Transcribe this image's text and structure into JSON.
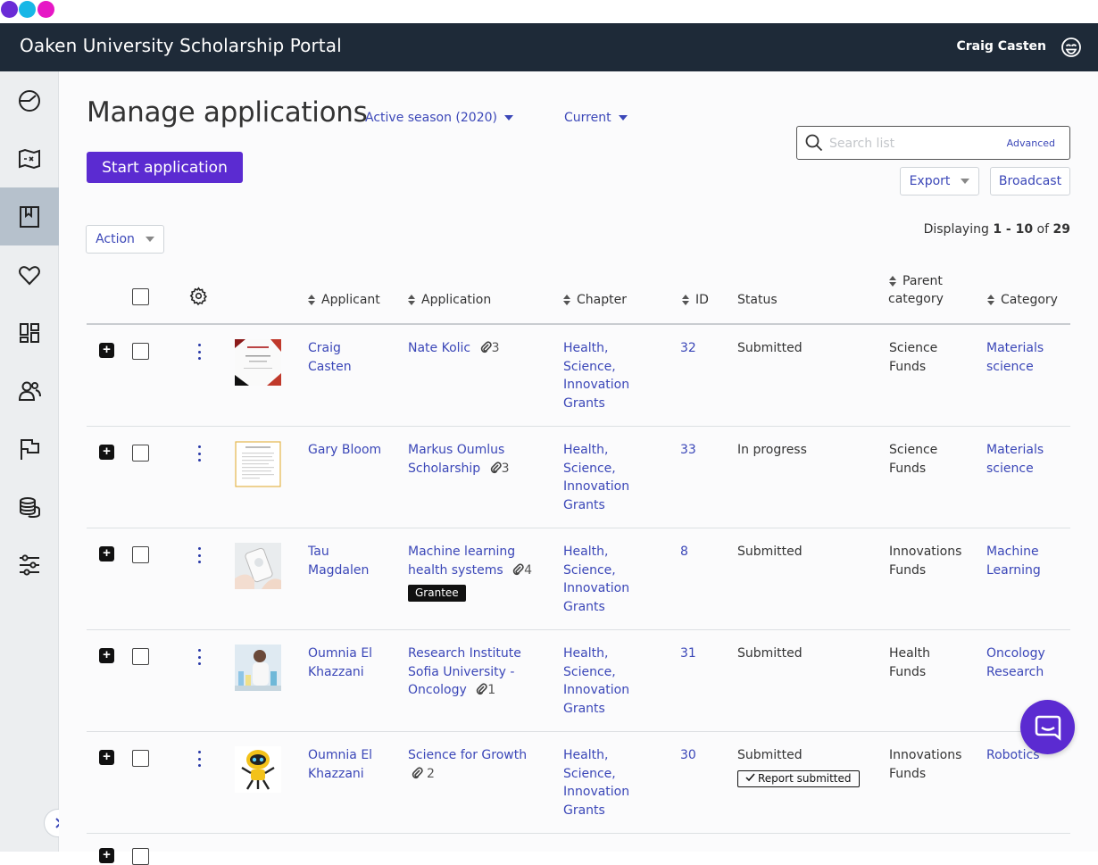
{
  "window": {
    "dot_colors": [
      "#6a2bd6",
      "#17b7e6",
      "#e617c5"
    ]
  },
  "header": {
    "title": "Oaken University Scholarship Portal",
    "user_name": "Craig Casten"
  },
  "sidebar": {
    "items": [
      {
        "icon": "dashboard-gauge-icon",
        "active": false
      },
      {
        "icon": "map-icon",
        "active": false
      },
      {
        "icon": "bookmark-icon",
        "active": true
      },
      {
        "icon": "heart-icon",
        "active": false
      },
      {
        "icon": "layout-grid-icon",
        "active": false
      },
      {
        "icon": "users-icon",
        "active": false
      },
      {
        "icon": "flag-icon",
        "active": false
      },
      {
        "icon": "coins-icon",
        "active": false
      },
      {
        "icon": "sliders-icon",
        "active": false
      }
    ],
    "expand_icon": "chevron-right-icon"
  },
  "main": {
    "page_title": "Manage applications",
    "season_filter": "Active season (2020)",
    "status_filter": "Current",
    "start_button": "Start application",
    "search": {
      "placeholder": "Search list",
      "advanced_label": "Advanced"
    },
    "export_label": "Export",
    "broadcast_label": "Broadcast",
    "action_label": "Action",
    "displaying": {
      "prefix": "Displaying ",
      "range": "1 - 10",
      "of": " of ",
      "total": "29"
    }
  },
  "table": {
    "columns": {
      "applicant": "Applicant",
      "application": "Application",
      "chapter": "Chapter",
      "id": "ID",
      "status": "Status",
      "parent_category_1": "Parent",
      "parent_category_2": "category",
      "category": "Category"
    },
    "rows": [
      {
        "applicant": [
          "Craig",
          "Casten"
        ],
        "application": [
          "Nate Kolic"
        ],
        "attachments": "3",
        "chapter": [
          "Health,",
          "Science,",
          "Innovation",
          "Grants"
        ],
        "id": "32",
        "status": "Submitted",
        "parent_category": [
          "Science",
          "Funds"
        ],
        "category": [
          "Materials",
          "science"
        ],
        "thumb": "certificate"
      },
      {
        "applicant": [
          "Gary Bloom"
        ],
        "application": [
          "Markus Oumlus",
          "Scholarship"
        ],
        "attachments": "3",
        "chapter": [
          "Health,",
          "Science,",
          "Innovation",
          "Grants"
        ],
        "id": "33",
        "status": "In progress",
        "parent_category": [
          "Science",
          "Funds"
        ],
        "category": [
          "Materials",
          "science"
        ],
        "thumb": "letter"
      },
      {
        "applicant": [
          "Tau",
          "Magdalen"
        ],
        "application": [
          "Machine learning",
          "health systems"
        ],
        "attachments": "4",
        "badge": "Grantee",
        "chapter": [
          "Health,",
          "Science,",
          "Innovation",
          "Grants"
        ],
        "id": "8",
        "status": "Submitted",
        "parent_category": [
          "Innovations",
          "Funds"
        ],
        "category": [
          "Machine",
          "Learning"
        ],
        "thumb": "device"
      },
      {
        "applicant": [
          "Oumnia El",
          "Khazzani"
        ],
        "application": [
          "Research Institute",
          "Sofia University -",
          "Oncology"
        ],
        "attachments": "1",
        "chapter": [
          "Health,",
          "Science,",
          "Innovation",
          "Grants"
        ],
        "id": "31",
        "status": "Submitted",
        "parent_category": [
          "Health",
          "Funds"
        ],
        "category": [
          "Oncology",
          "Research"
        ],
        "thumb": "lab"
      },
      {
        "applicant": [
          "Oumnia El",
          "Khazzani"
        ],
        "application": [
          "Science for Growth"
        ],
        "attachments": "2",
        "chapter": [
          "Health,",
          "Science,",
          "Innovation",
          "Grants"
        ],
        "id": "30",
        "status": "Submitted",
        "report_badge": "Report submitted",
        "parent_category": [
          "Innovations",
          "Funds"
        ],
        "category": [
          "Robotics"
        ],
        "thumb": "robot"
      }
    ]
  },
  "chat": {
    "icon": "chat-bubble-icon",
    "color": "#5b2bd1"
  }
}
